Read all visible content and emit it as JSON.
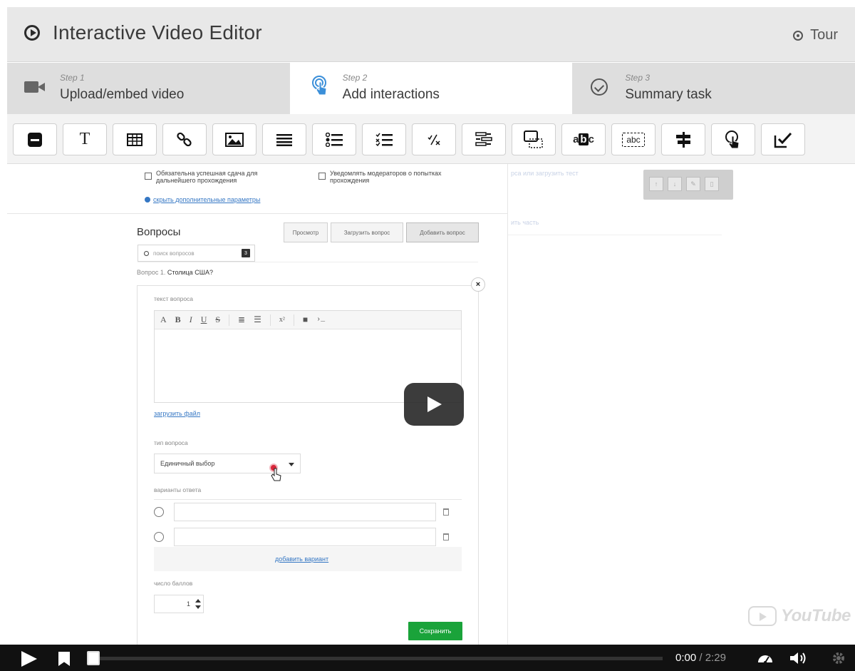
{
  "header": {
    "title": "Interactive Video Editor",
    "tour_label": "Tour"
  },
  "steps": [
    {
      "num": "Step 1",
      "label": "Upload/embed video",
      "icon": "video-camera-icon"
    },
    {
      "num": "Step 2",
      "label": "Add interactions",
      "icon": "touch-icon"
    },
    {
      "num": "Step 3",
      "label": "Summary task",
      "icon": "check-circle-icon"
    }
  ],
  "active_step": "Step 2",
  "toolbar": {
    "text_tool": "T",
    "fill_words_tool": "abc",
    "fill_words_tool_prefix": "a",
    "fill_words_tool_suffix": "c",
    "fill_words_tool_mid": "b",
    "fraction_tool": "⁄",
    "fraction_sup": "✓",
    "fraction_sub": "x"
  },
  "form": {
    "checkbox_required": "Обязательна успешная сдача для дальнейшего прохождения",
    "checkbox_notify": "Уведомлять модераторов о попытках прохождения",
    "hide_params_link": "скрыть дополнительные параметры",
    "right_faint_top": "рса  или  загрузить тест",
    "right_faint_part": "ить часть"
  },
  "questions": {
    "title": "Вопросы",
    "buttons": [
      "Просмотр",
      "Загрузить вопрос",
      "Добавить вопрос"
    ],
    "search_placeholder": "поиск вопросов",
    "search_count": "3",
    "question_prefix": "Вопрос 1.",
    "question_text": "Столица США?"
  },
  "question_card": {
    "text_label": "текст вопроса",
    "editor_buttons": [
      "A",
      "B",
      "I",
      "U",
      "S",
      "x²",
      "›_"
    ],
    "upload_link": "загрузить файл",
    "type_label": "тип вопроса",
    "type_value": "Единичный выбор",
    "answers_label": "варианты ответа",
    "add_variant": "добавить вариант",
    "points_label": "число баллов",
    "points_value": "1",
    "save_button": "Сохранить"
  },
  "player": {
    "time_current": "0:00",
    "time_separator": "/",
    "time_total": "2:29",
    "youtube_logo": "YouTube"
  },
  "colors": {
    "header_bg": "#e8e8e8",
    "step_active_bg": "#ffffff",
    "link": "#3577c4",
    "save_green": "#1aa33a",
    "player_bar": "#111111"
  }
}
